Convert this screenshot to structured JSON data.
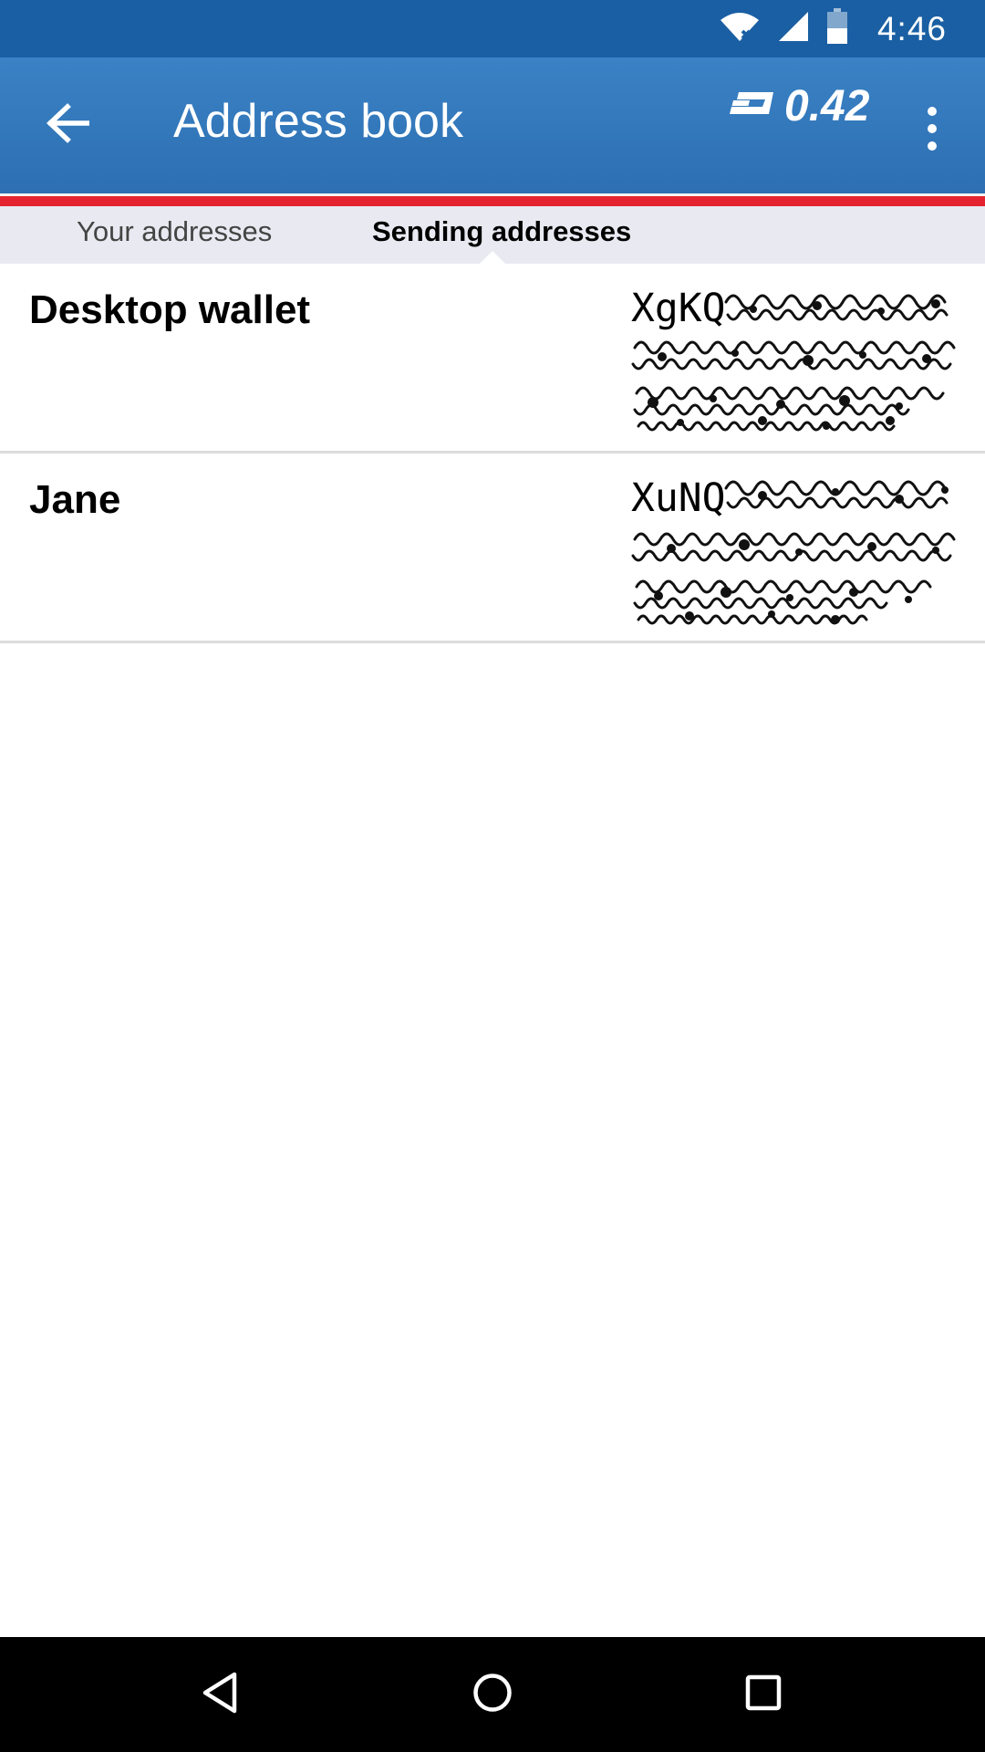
{
  "status_bar": {
    "time": "4:46",
    "icons": [
      "wifi-no-internet-icon",
      "cell-signal-icon",
      "battery-icon"
    ]
  },
  "app_bar": {
    "title": "Address book",
    "balance": "0.42",
    "back_icon": "arrow-back-icon",
    "currency_icon": "dash-logo-icon",
    "menu_icon": "more-vert-icon"
  },
  "colors": {
    "status_bar": "#1a5fa3",
    "app_bar": "#3479bd",
    "accent_strip": "#e52330",
    "tab_bar": "#e9eaf1"
  },
  "tabs": [
    {
      "label": "Your addresses",
      "selected": false
    },
    {
      "label": "Sending addresses",
      "selected": true
    }
  ],
  "addresses": [
    {
      "label": "Desktop wallet",
      "address_prefix": "XgKQ",
      "address_obscured": true
    },
    {
      "label": "Jane",
      "address_prefix": "XuNQ",
      "address_obscured": true
    }
  ],
  "nav_bar": {
    "icons": [
      "nav-back-icon",
      "nav-home-icon",
      "nav-recents-icon"
    ]
  }
}
